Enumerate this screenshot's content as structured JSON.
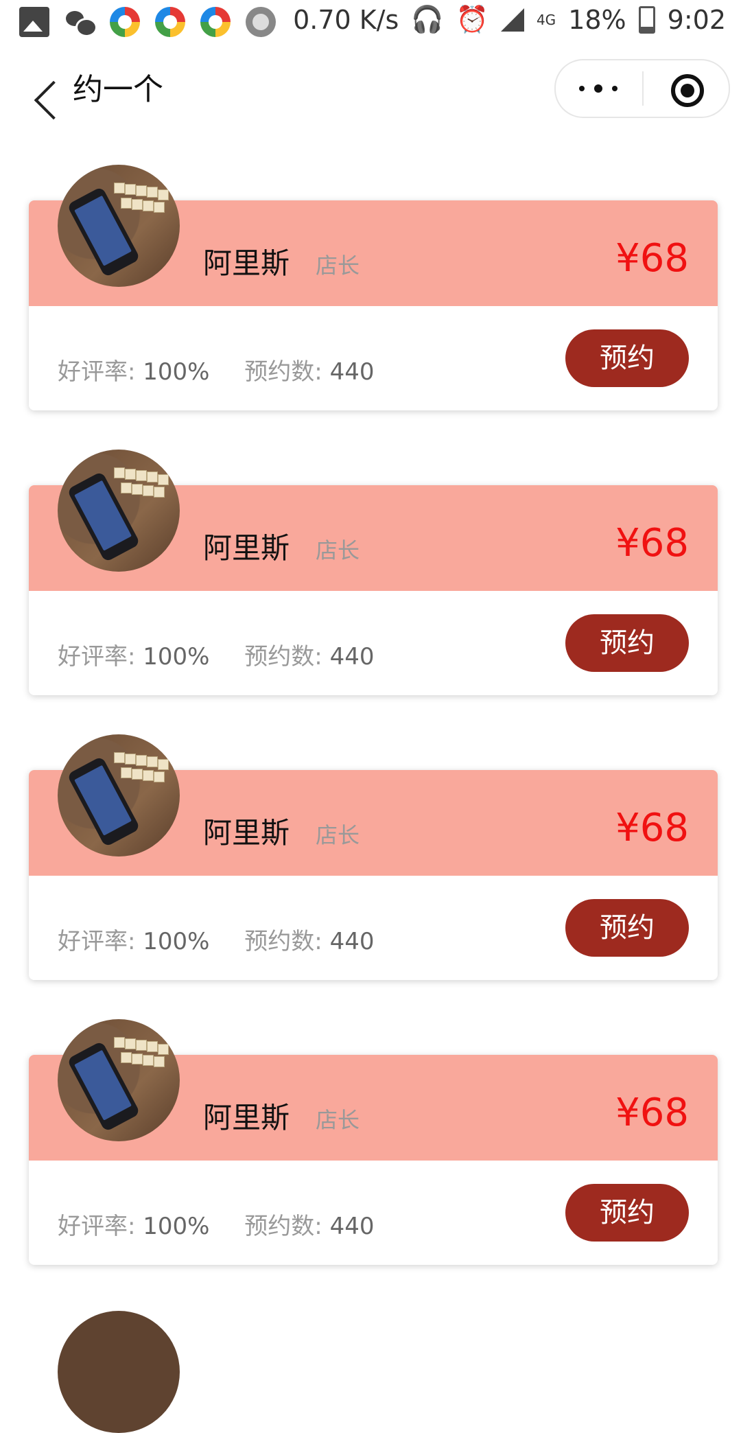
{
  "statusbar": {
    "net_speed": "0.70 K/s",
    "battery": "18%",
    "time": "9:02",
    "network": "4G"
  },
  "navbar": {
    "title": "约一个"
  },
  "cards": [
    {
      "name": "阿里斯",
      "role": "店长",
      "price": "¥68",
      "rating_label": "好评率:",
      "rating_value": "100%",
      "count_label": "预约数:",
      "count_value": "440",
      "button": "预约"
    },
    {
      "name": "阿里斯",
      "role": "店长",
      "price": "¥68",
      "rating_label": "好评率:",
      "rating_value": "100%",
      "count_label": "预约数:",
      "count_value": "440",
      "button": "预约"
    },
    {
      "name": "阿里斯",
      "role": "店长",
      "price": "¥68",
      "rating_label": "好评率:",
      "rating_value": "100%",
      "count_label": "预约数:",
      "count_value": "440",
      "button": "预约"
    },
    {
      "name": "阿里斯",
      "role": "店长",
      "price": "¥68",
      "rating_label": "好评率:",
      "rating_value": "100%",
      "count_label": "预约数:",
      "count_value": "440",
      "button": "预约"
    }
  ],
  "colors": {
    "card_header": "#f9a89b",
    "price": "#f01111",
    "button": "#9e2a1f"
  }
}
